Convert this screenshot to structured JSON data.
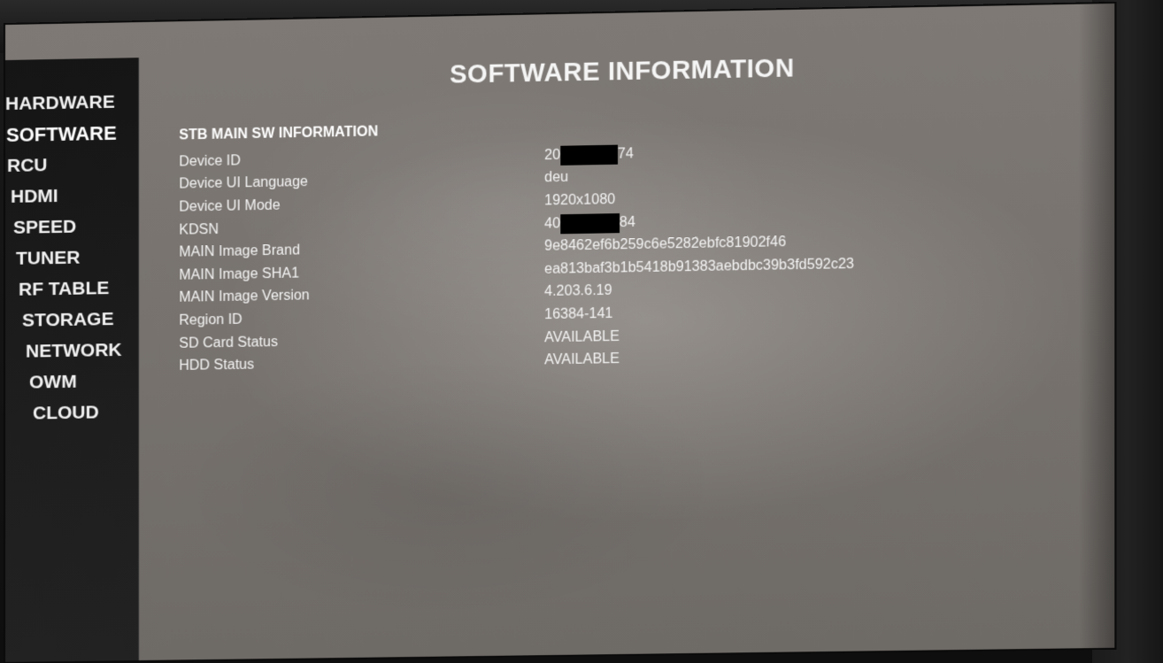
{
  "sidebar": {
    "items": [
      {
        "label": "HARDWARE",
        "active": false
      },
      {
        "label": "SOFTWARE",
        "active": true
      },
      {
        "label": "RCU",
        "active": false
      },
      {
        "label": "HDMI",
        "active": false
      },
      {
        "label": "SPEED",
        "active": false
      },
      {
        "label": "TUNER",
        "active": false
      },
      {
        "label": "RF TABLE",
        "active": false
      },
      {
        "label": "STORAGE",
        "active": false
      },
      {
        "label": "NETWORK",
        "active": false
      },
      {
        "label": "OWM",
        "active": false
      },
      {
        "label": "CLOUD",
        "active": false
      }
    ]
  },
  "main": {
    "title": "SOFTWARE INFORMATION",
    "section_heading": "STB MAIN SW INFORMATION",
    "rows": [
      {
        "label": "Device ID",
        "value_prefix": "20",
        "value_suffix": "74",
        "redacted": true
      },
      {
        "label": "Device UI Language",
        "value": "deu"
      },
      {
        "label": "Device UI Mode",
        "value": "1920x1080"
      },
      {
        "label": "KDSN",
        "value_prefix": "40",
        "value_suffix": "84",
        "redacted": true
      },
      {
        "label": "MAIN Image Brand",
        "value": "9e8462ef6b259c6e5282ebfc81902f46"
      },
      {
        "label": "MAIN Image SHA1",
        "value": "ea813baf3b1b5418b91383aebdbc39b3fd592c23"
      },
      {
        "label": "MAIN Image Version",
        "value": "4.203.6.19"
      },
      {
        "label": "Region ID",
        "value": "16384-141"
      },
      {
        "label": "SD Card Status",
        "value": "AVAILABLE"
      },
      {
        "label": "HDD Status",
        "value": "AVAILABLE"
      }
    ]
  },
  "colors": {
    "screen_background": "#7a7571",
    "sidebar_background": "#1a1a1a",
    "text": "#f4f4f4",
    "redaction": "#000000"
  }
}
